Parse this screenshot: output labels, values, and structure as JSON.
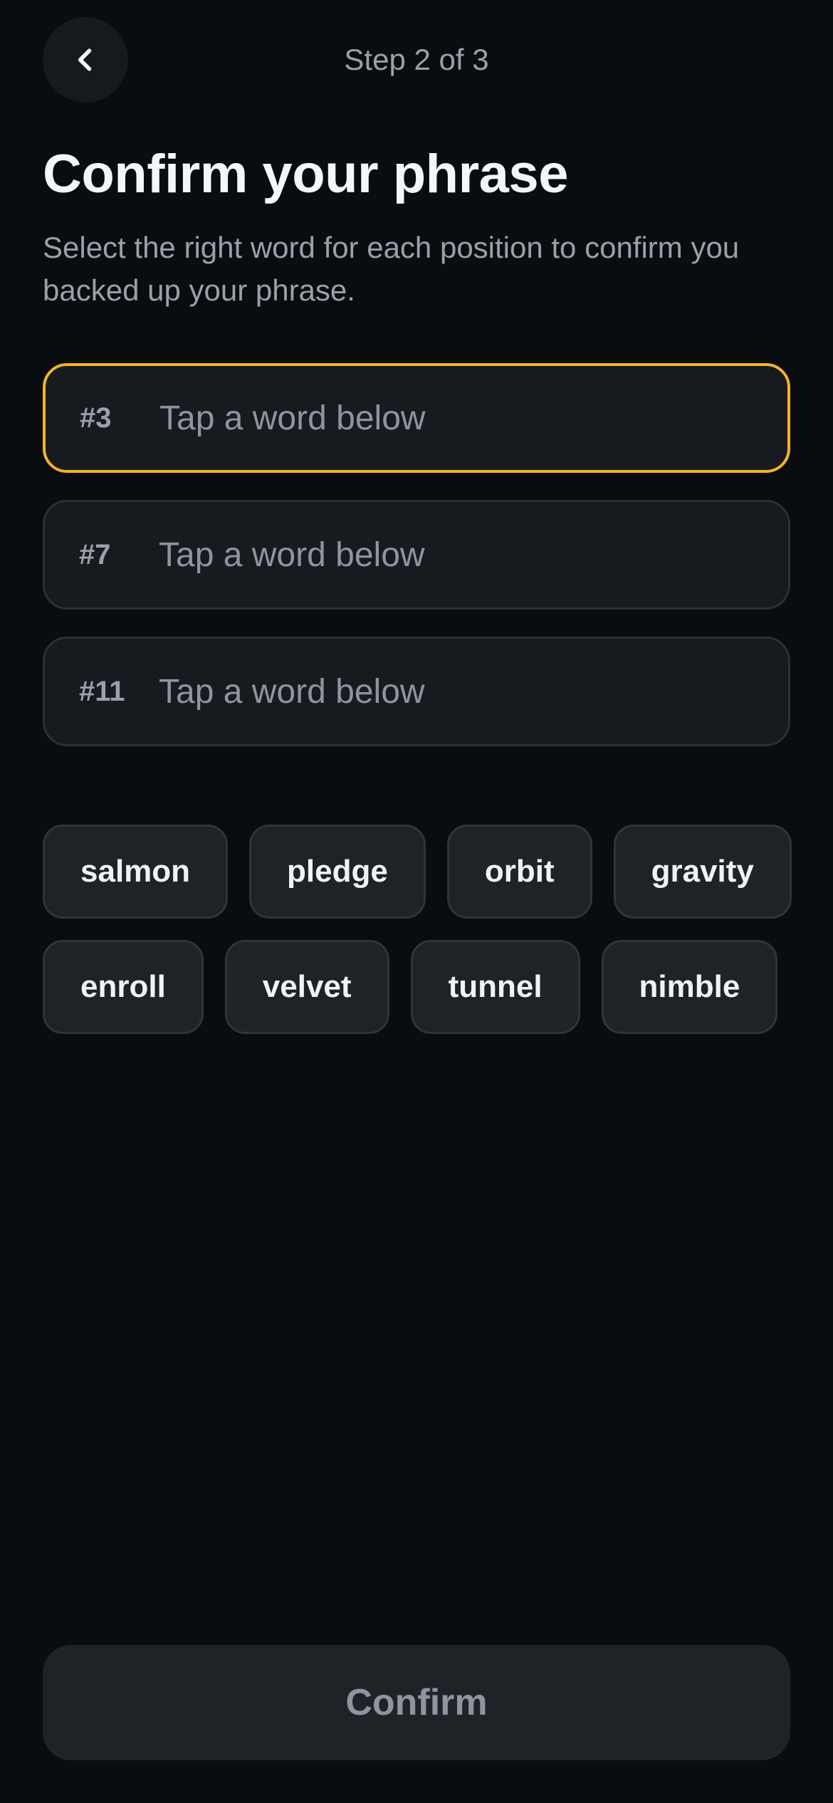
{
  "header": {
    "back_icon": "chevron-left-icon",
    "step_label": "Step 2 of 3"
  },
  "title": "Confirm your phrase",
  "subtitle": "Select the right word for each position to confirm you backed up your phrase.",
  "slots": [
    {
      "number": "#3",
      "placeholder": "Tap a word below",
      "active": true
    },
    {
      "number": "#7",
      "placeholder": "Tap a word below",
      "active": false
    },
    {
      "number": "#11",
      "placeholder": "Tap a word below",
      "active": false
    }
  ],
  "word_rows": [
    [
      "salmon",
      "pledge",
      "orbit",
      "gravity"
    ],
    [
      "enroll",
      "velvet",
      "tunnel",
      "nimble"
    ]
  ],
  "confirm_label": "Confirm",
  "colors": {
    "background": "#0a0d10",
    "accent": "#f0b429",
    "surface": "#171a1e",
    "chip": "#1f2328",
    "muted_text": "#9aa1ab"
  }
}
